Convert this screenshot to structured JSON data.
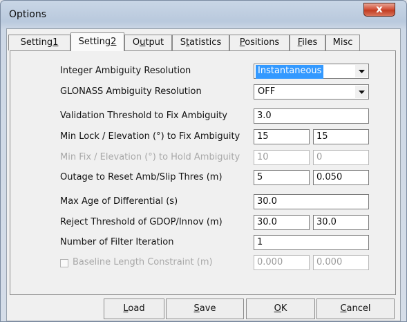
{
  "window": {
    "title": "Options",
    "close_glyph": "x"
  },
  "tabs": [
    {
      "pre": "Setting",
      "key": "1",
      "post": "",
      "active": false
    },
    {
      "pre": "Setting",
      "key": "2",
      "post": "",
      "active": true
    },
    {
      "pre": "O",
      "key": "u",
      "post": "tput",
      "active": false
    },
    {
      "pre": "S",
      "key": "t",
      "post": "atistics",
      "active": false
    },
    {
      "pre": "",
      "key": "P",
      "post": "ositions",
      "active": false
    },
    {
      "pre": "",
      "key": "F",
      "post": "iles",
      "active": false
    },
    {
      "pre": "Misc",
      "key": "",
      "post": "",
      "active": false
    }
  ],
  "settings": {
    "integer_ambiguity": {
      "label": "Integer Ambiguity Resolution",
      "value": "Instantaneous"
    },
    "glonass_ambiguity": {
      "label": "GLONASS Ambiguity Resolution",
      "value": "OFF"
    },
    "validation_threshold": {
      "label": "Validation Threshold to Fix Ambiguity",
      "value": "3.0"
    },
    "min_lock_fix": {
      "label": "Min Lock / Elevation (°) to Fix Ambiguity",
      "value1": "15",
      "value2": "15"
    },
    "min_fix_hold": {
      "label": "Min Fix / Elevation (°) to Hold Ambiguity",
      "value1": "10",
      "value2": "0"
    },
    "outage_reset": {
      "label": "Outage to Reset Amb/Slip Thres (m)",
      "value1": "5",
      "value2": "0.050"
    },
    "max_age_diff": {
      "label": "Max Age of Differential (s)",
      "value": "30.0"
    },
    "reject_threshold": {
      "label": "Reject Threshold of GDOP/Innov (m)",
      "value1": "30.0",
      "value2": "30.0"
    },
    "filter_iteration": {
      "label": "Number of Filter Iteration",
      "value": "1"
    },
    "baseline_constraint": {
      "label": "Baseline Length Constraint (m)",
      "checked": false,
      "value1": "0.000",
      "value2": "0.000"
    }
  },
  "buttons": {
    "load": {
      "key": "L",
      "rest": "oad"
    },
    "save": {
      "key": "S",
      "rest": "ave"
    },
    "ok": {
      "key": "O",
      "rest": "K"
    },
    "cancel": {
      "key": "C",
      "rest": "ancel"
    }
  }
}
